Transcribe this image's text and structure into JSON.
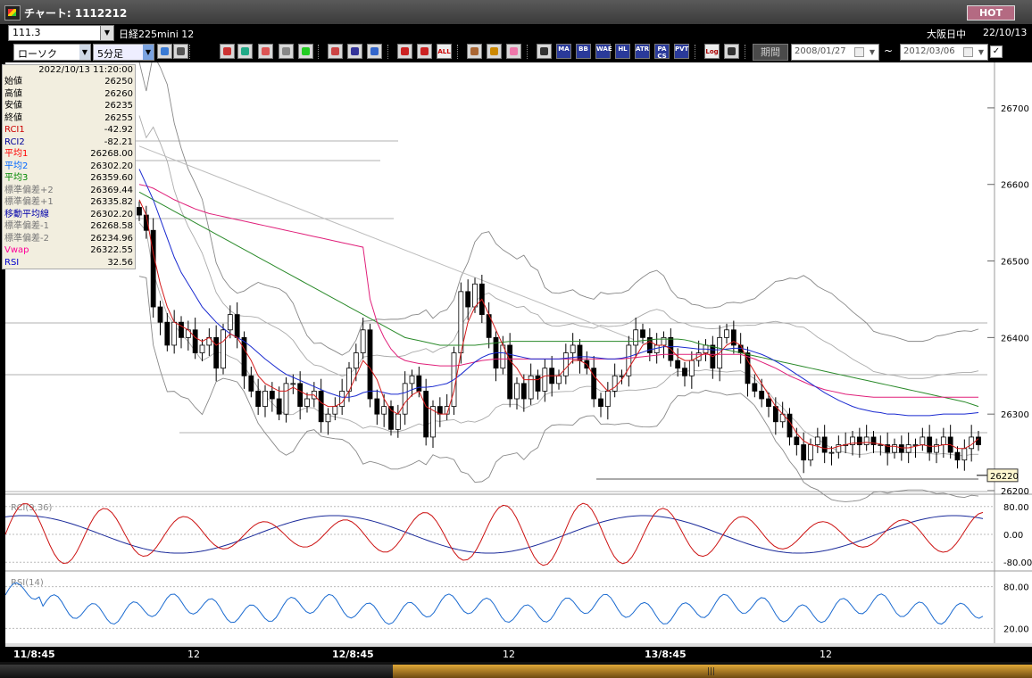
{
  "window": {
    "title": "チャート: 1112212",
    "hot_label": "HOT"
  },
  "header": {
    "symbol_code": "111.3",
    "symbol_name": "日経225mini 12",
    "market": "大阪日中",
    "date": "22/10/13"
  },
  "toolbar": {
    "chart_type": "ローソク",
    "period": "5分足",
    "indicator_buttons": [
      "MA",
      "BB",
      "WAE",
      "HL",
      "ATR",
      "PA\nCS",
      "PVT"
    ],
    "log_label": "Log",
    "all_label": "ALL",
    "period_button": "期間",
    "date_from": "2008/01/27",
    "date_to": "2012/03/06",
    "tilde": "~",
    "icons": [
      "zoom-icon",
      "crosshair-icon",
      "candle-icon",
      "zoom-in-icon",
      "chart-icon",
      "arrow-icon",
      "line-draw-icon",
      "pencil-icon",
      "pointer-icon",
      "redo-icon",
      "scroll-left-icon",
      "scroll-right-icon",
      "wrench-icon",
      "tool-icon",
      "color-icon",
      "table-icon",
      "window-icon"
    ]
  },
  "info_panel": {
    "datetime": "2022/10/13 11:20:00",
    "rows": [
      {
        "label": "始値",
        "value": "26250",
        "color": "#000000"
      },
      {
        "label": "高値",
        "value": "26260",
        "color": "#000000"
      },
      {
        "label": "安値",
        "value": "26235",
        "color": "#000000"
      },
      {
        "label": "終値",
        "value": "26255",
        "color": "#000000"
      },
      {
        "label": "RCI1",
        "value": "-42.92",
        "color": "#cc0000"
      },
      {
        "label": "RCI2",
        "value": "-82.21",
        "color": "#000099"
      },
      {
        "label": "平均1",
        "value": "26268.00",
        "color": "#ff0000"
      },
      {
        "label": "平均2",
        "value": "26302.20",
        "color": "#0066ff"
      },
      {
        "label": "平均3",
        "value": "26359.60",
        "color": "#008800"
      },
      {
        "label": "標準偏差+2",
        "value": "26369.44",
        "color": "#777777"
      },
      {
        "label": "標準偏差+1",
        "value": "26335.82",
        "color": "#777777"
      },
      {
        "label": "移動平均線",
        "value": "26302.20",
        "color": "#0000aa"
      },
      {
        "label": "標準偏差-1",
        "value": "26268.58",
        "color": "#777777"
      },
      {
        "label": "標準偏差-2",
        "value": "26234.96",
        "color": "#777777"
      },
      {
        "label": "Vwap",
        "value": "26322.55",
        "color": "#ff0099"
      },
      {
        "label": "RSI",
        "value": "32.56",
        "color": "#0000cc"
      }
    ]
  },
  "chart_data": {
    "type": "line",
    "price_axis": {
      "ylim": [
        26200,
        26750
      ],
      "ticks": [
        "26700",
        "26600",
        "26500",
        "26400",
        "26300",
        "26200"
      ]
    },
    "current_price": "26220",
    "x_ticks": [
      "11/8:45",
      "12",
      "12/8:45",
      "12",
      "13/8:45",
      "12"
    ],
    "price_series": {
      "close": [
        26560,
        26540,
        26440,
        26420,
        26390,
        26420,
        26400,
        26410,
        26380,
        26390,
        26400,
        26360,
        26410,
        26430,
        26400,
        26350,
        26330,
        26310,
        26330,
        26320,
        26300,
        26340,
        26340,
        26310,
        26320,
        26330,
        26290,
        26300,
        26310,
        26330,
        26360,
        26380,
        26410,
        26320,
        26300,
        26310,
        26280,
        26300,
        26340,
        26350,
        26330,
        26270,
        26310,
        26300,
        26310,
        26380,
        26460,
        26440,
        26470,
        26430,
        26400,
        26360,
        26390,
        26320,
        26340,
        26320,
        26350,
        26330,
        26360,
        26340,
        26350,
        26380,
        26390,
        26370,
        26360,
        26320,
        26310,
        26330,
        26350,
        26350,
        26390,
        26410,
        26400,
        26380,
        26390,
        26400,
        26370,
        26360,
        26350,
        26370,
        26380,
        26390,
        26360,
        26400,
        26410,
        26390,
        26380,
        26340,
        26330,
        26320,
        26310,
        26290,
        26300,
        26270,
        26260,
        26240,
        26260,
        26270,
        26250,
        26250,
        26260,
        26260,
        26270,
        26260,
        26270,
        26260,
        26260,
        26250,
        26260,
        26250,
        26260,
        26260,
        26270,
        26250,
        26260,
        26270,
        26250,
        26240,
        26255,
        26270,
        26260
      ],
      "ma1": [
        26580,
        26560,
        26510,
        26470,
        26440,
        26420,
        26415,
        26410,
        26400,
        26395,
        26400,
        26390,
        26395,
        26405,
        26400,
        26385,
        26370,
        26350,
        26340,
        26335,
        26330,
        26330,
        26335,
        26330,
        26325,
        26325,
        26315,
        26310,
        26310,
        26315,
        26330,
        26350,
        26370,
        26360,
        26345,
        26320,
        26305,
        26300,
        26315,
        26325,
        26330,
        26310,
        26305,
        26300,
        26300,
        26330,
        26380,
        26420,
        26440,
        26450,
        26430,
        26410,
        26390,
        26370,
        26360,
        26345,
        26345,
        26345,
        26350,
        26350,
        26350,
        26360,
        26370,
        26370,
        26365,
        26350,
        26340,
        26330,
        26335,
        26345,
        26360,
        26375,
        26390,
        26395,
        26390,
        26390,
        26385,
        26375,
        26370,
        26370,
        26375,
        26380,
        26375,
        26380,
        26390,
        26395,
        26390,
        26370,
        26355,
        26340,
        26325,
        26310,
        26300,
        26290,
        26275,
        26265,
        26260,
        26258,
        26255,
        26255,
        26258,
        26260,
        26262,
        26262,
        26263,
        26262,
        26261,
        26258,
        26258,
        26256,
        26256,
        26258,
        26260,
        26258,
        26258,
        26260,
        26260,
        26255,
        26255,
        26260,
        26268
      ],
      "ma2": [
        26620,
        26600,
        26580,
        26555,
        26530,
        26505,
        26485,
        26470,
        26455,
        26440,
        26430,
        26420,
        26412,
        26405,
        26400,
        26395,
        26388,
        26380,
        26372,
        26365,
        26358,
        26352,
        26348,
        26344,
        26340,
        26336,
        26332,
        26328,
        26325,
        26322,
        26322,
        26324,
        26328,
        26330,
        26330,
        26328,
        26326,
        26326,
        26328,
        26332,
        26335,
        26335,
        26336,
        26338,
        26340,
        26345,
        26352,
        26360,
        26368,
        26374,
        26378,
        26380,
        26380,
        26378,
        26376,
        26374,
        26372,
        26372,
        26372,
        26372,
        26372,
        26373,
        26374,
        26375,
        26375,
        26374,
        26373,
        26372,
        26372,
        26373,
        26375,
        26378,
        26381,
        26384,
        26386,
        26388,
        26388,
        26388,
        26387,
        26386,
        26385,
        26385,
        26384,
        26384,
        26385,
        26386,
        26386,
        26384,
        26381,
        26378,
        26374,
        26369,
        26364,
        26358,
        26352,
        26346,
        26340,
        26334,
        26328,
        26323,
        26318,
        26314,
        26310,
        26307,
        26305,
        26303,
        26302,
        26300,
        26300,
        26299,
        26298,
        26298,
        26298,
        26298,
        26299,
        26300,
        26300,
        26300,
        26300,
        26301,
        26302
      ],
      "ma3": [
        26590,
        26585,
        26580,
        26575,
        26570,
        26565,
        26560,
        26555,
        26550,
        26545,
        26540,
        26535,
        26530,
        26525,
        26520,
        26515,
        26510,
        26505,
        26500,
        26495,
        26490,
        26485,
        26480,
        26475,
        26470,
        26465,
        26460,
        26455,
        26450,
        26445,
        26440,
        26435,
        26430,
        26425,
        26420,
        26415,
        26410,
        26405,
        26400,
        26398,
        26396,
        26394,
        26392,
        26390,
        26390,
        26390,
        26390,
        26390,
        26390,
        26391,
        26392,
        26393,
        26394,
        26395,
        26395,
        26395,
        26395,
        26395,
        26395,
        26395,
        26395,
        26395,
        26395,
        26395,
        26395,
        26395,
        26395,
        26395,
        26395,
        26395,
        26395,
        26395,
        26396,
        26397,
        26398,
        26398,
        26398,
        26398,
        26397,
        26395,
        26392,
        26390,
        26388,
        26386,
        26384,
        26382,
        26380,
        26378,
        26376,
        26374,
        26372,
        26370,
        26368,
        26366,
        26364,
        26362,
        26360,
        26358,
        26356,
        26354,
        26352,
        26350,
        26348,
        26346,
        26344,
        26342,
        26340,
        26338,
        26336,
        26334,
        26332,
        26330,
        26328,
        26326,
        26324,
        26322,
        26320,
        26318,
        26316,
        26313,
        26310
      ],
      "vwap": [
        26600,
        26598,
        26595,
        26590,
        26585,
        26580,
        26576,
        26572,
        26568,
        26565,
        26562,
        26560,
        26558,
        26556,
        26554,
        26552,
        26550,
        26548,
        26546,
        26544,
        26542,
        26540,
        26538,
        26536,
        26534,
        26532,
        26530,
        26528,
        26526,
        26524,
        26522,
        26520,
        26518,
        26450,
        26420,
        26400,
        26385,
        26375,
        26370,
        26368,
        26366,
        26365,
        26364,
        26363,
        26363,
        26363,
        26364,
        26366,
        26368,
        26370,
        26371,
        26372,
        26372,
        26372,
        26372,
        26372,
        26372,
        26372,
        26372,
        26372,
        26372,
        26372,
        26372,
        26372,
        26372,
        26372,
        26372,
        26372,
        26372,
        26372,
        26373,
        26374,
        26375,
        26376,
        26377,
        26378,
        26378,
        26378,
        26378,
        26378,
        26378,
        26378,
        26378,
        26378,
        26378,
        26378,
        26378,
        26375,
        26372,
        26368,
        26364,
        26360,
        26355,
        26350,
        26346,
        26342,
        26338,
        26335,
        26332,
        26330,
        26328,
        26326,
        26325,
        26324,
        26323,
        26322,
        26322,
        26322,
        26322,
        26322,
        26322,
        26322,
        26322,
        26322,
        26322,
        26322,
        26322,
        26322,
        26322,
        26322,
        26322
      ]
    },
    "rci_panel": {
      "label": "RCI(9,36)",
      "ylim": [
        -100,
        100
      ],
      "ticks": [
        "80.00",
        "0.00",
        "-80.00"
      ]
    },
    "rsi_panel": {
      "label": "RSI(14)",
      "ylim": [
        0,
        100
      ],
      "ticks": [
        "80.00",
        "20.00"
      ]
    }
  }
}
